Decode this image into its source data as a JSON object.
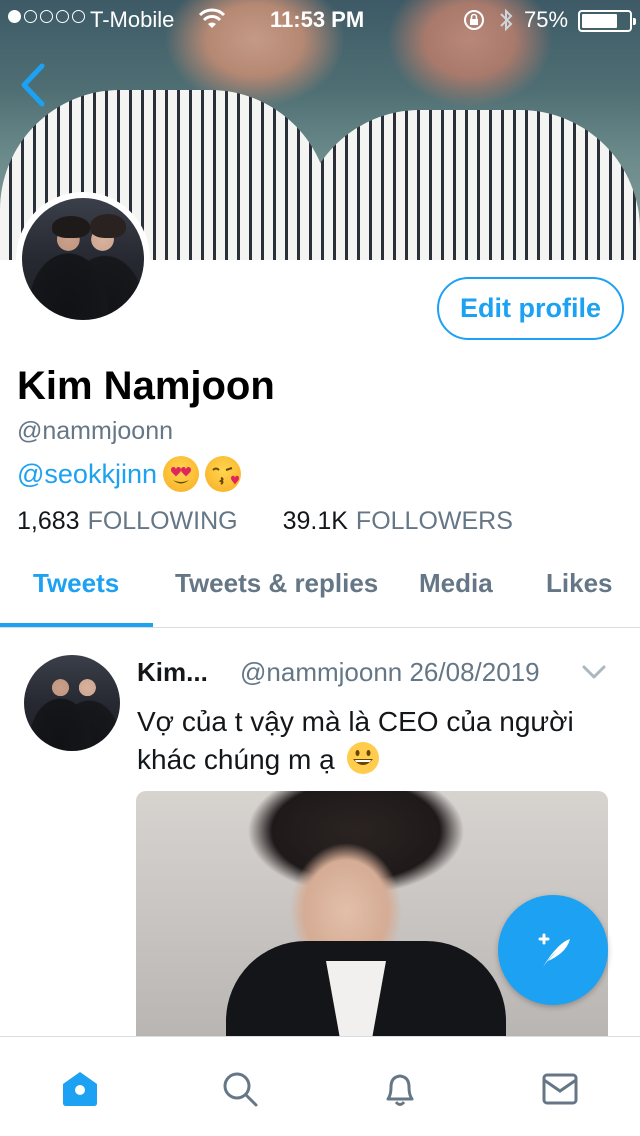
{
  "status_bar": {
    "carrier": "T-Mobile",
    "time": "11:53 PM",
    "battery": "75%",
    "battery_level": 0.75,
    "signal_bars_filled": 1,
    "signal_bars_total": 5
  },
  "profile": {
    "edit_button_label": "Edit profile",
    "name": "Kim Namjoon",
    "handle": "@nammjoonn",
    "bio_mention": "@seokkjinn",
    "bio_emojis": [
      "heart-eyes-emoji",
      "kiss-emoji"
    ],
    "following_count": "1,683",
    "following_label": "FOLLOWING",
    "followers_count": "39.1K",
    "followers_label": "FOLLOWERS"
  },
  "tabs": [
    {
      "label": "Tweets",
      "active": true
    },
    {
      "label": "Tweets & replies",
      "active": false
    },
    {
      "label": "Media",
      "active": false
    },
    {
      "label": "Likes",
      "active": false
    }
  ],
  "tweet": {
    "author_name": "Kim...",
    "meta": "@nammjoonn 26/08/2019",
    "text": "Vợ của t vậy mà là CEO của người khác chúng m ạ"
  },
  "bottom_nav": {
    "items": [
      "home-icon",
      "search-icon",
      "notifications-icon",
      "messages-icon"
    ]
  },
  "colors": {
    "accent": "#1da1f2",
    "secondary_text": "#657786",
    "divider": "#d7dde2"
  }
}
